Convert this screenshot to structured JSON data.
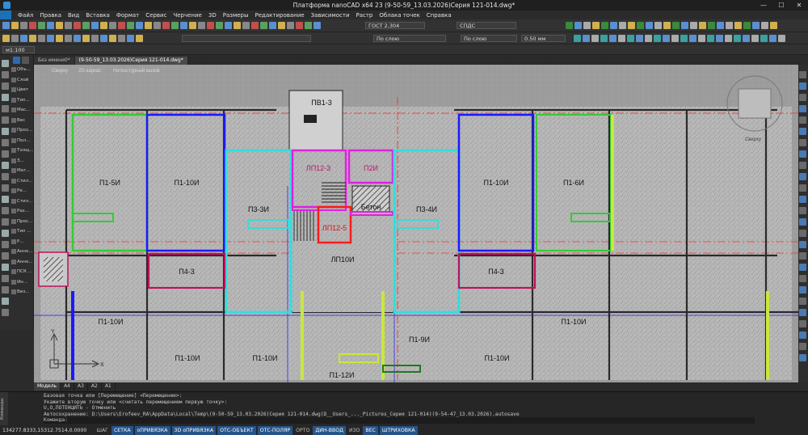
{
  "window": {
    "title": "Платформа nanoCAD x64 23 (9-50-59_13.03.2026)Серия 121-014.dwg*",
    "controls": [
      "—",
      "☐",
      "✕"
    ]
  },
  "menu": [
    "Файл",
    "Правка",
    "Вид",
    "Вставка",
    "Формат",
    "Сервис",
    "Черчение",
    "3D",
    "Размеры",
    "Редактирование",
    "Зависимости",
    "Растр",
    "Облака точек",
    "Справка"
  ],
  "toolbar": {
    "text_style": "ГОСТ 2.304",
    "dim_style": "СПДС",
    "layer_color": "По слою",
    "linetype": "По слою",
    "lineweight": "0.50 мм",
    "scale": "м1:100"
  },
  "properties_panel": [
    "Объ...",
    "Слой",
    "Цвет",
    "Тип...",
    "Мас...",
    "Вес",
    "Проз...",
    "Пол...",
    "Толщ...",
    "З...",
    "Мат...",
    "Стил...",
    "Ре...",
    "Стил...",
    "Раз...",
    "Прос...",
    "Тип ...",
    "Р...",
    "Анно...",
    "Анно...",
    "ПСК ...",
    "Ин...",
    "Виз..."
  ],
  "document_tabs": [
    {
      "label": "Без имени0*",
      "active": false
    },
    {
      "label": "(9-50-59_13.03.2026)Серия 121-014.dwg*",
      "active": true
    }
  ],
  "viewport_controls": [
    "Сверху",
    "2D-каркас",
    "Нетекстурный вызов"
  ],
  "viewcube_label": "Сверху",
  "drawing": {
    "labels": {
      "pv": "ПВ1-3",
      "p1_5": "П1-5И",
      "p1_10a": "П1-10И",
      "p3_3": "П3-3И",
      "lp12_3": "ЛП12-3",
      "p2": "П2И",
      "beton": "Бетон",
      "lp12_5": "ЛП12-5",
      "p3_4": "П3-4И",
      "p1_10b": "П1-10И",
      "p1_6": "П1-6И",
      "p4_3a": "П4-3",
      "lp10": "ЛП10И",
      "p4_3b": "П4-3",
      "p1_10c": "П1-10И",
      "p1_10d": "П1-10И",
      "p1_10e": "П1-10И",
      "p1_9": "П1-9И",
      "p1_12": "П1-12И",
      "p1_10f": "П1-10И",
      "p1_10g": "П1-10И",
      "axis_x": "X",
      "axis_y": "Y"
    }
  },
  "layout_tabs": [
    {
      "label": "Модель",
      "active": true
    },
    {
      "label": "A4",
      "active": false
    },
    {
      "label": "A3",
      "active": false
    },
    {
      "label": "A2",
      "active": false
    },
    {
      "label": "A1",
      "active": false
    }
  ],
  "command_side": "Команды",
  "command_history": [
    "Базовая точка или [Перемещение] <Перемещение>:",
    "Укажите вторую точку или <считать перемещением первую точку>:",
    "U,О,ПОТЕНЦИТЬ - Отменить",
    "Автосохранение: D:\\Users\\Erofeev_RA\\AppData\\Local\\Temp\\(9-50-59_13.03.2026)Серия 121-014.dwg(D__Users_..._Pictures_Серия 121-014)(9-54-47_13.03.2026).autosave"
  ],
  "command_prompt": "Команда:",
  "status": {
    "coords": "134277.8333,15312.7514,0.0000",
    "buttons": [
      {
        "label": "ШАГ",
        "on": false
      },
      {
        "label": "СЕТКА",
        "on": true
      },
      {
        "label": "оПРИВЯЗКА",
        "on": true
      },
      {
        "label": "3D оПРИВЯЗКА",
        "on": true
      },
      {
        "label": "ОТС-ОБЪЕКТ",
        "on": true
      },
      {
        "label": "ОТС-ПОЛЯР",
        "on": true
      },
      {
        "label": "ОРТО",
        "on": false
      },
      {
        "label": "ДИН-ВВОД",
        "on": true
      },
      {
        "label": "ИЗО",
        "on": false
      },
      {
        "label": "ВЕС",
        "on": true
      },
      {
        "label": "ШТРИХОВКА",
        "on": true
      }
    ]
  },
  "colors": {
    "background": "#9d9d9d",
    "green": "#33cc33",
    "blue": "#1a1aff",
    "cyan": "#33dddd",
    "magenta": "#e020e0",
    "red": "#ff1a1a",
    "yellow_green": "#c8e83c",
    "status_on": "#26548a"
  }
}
